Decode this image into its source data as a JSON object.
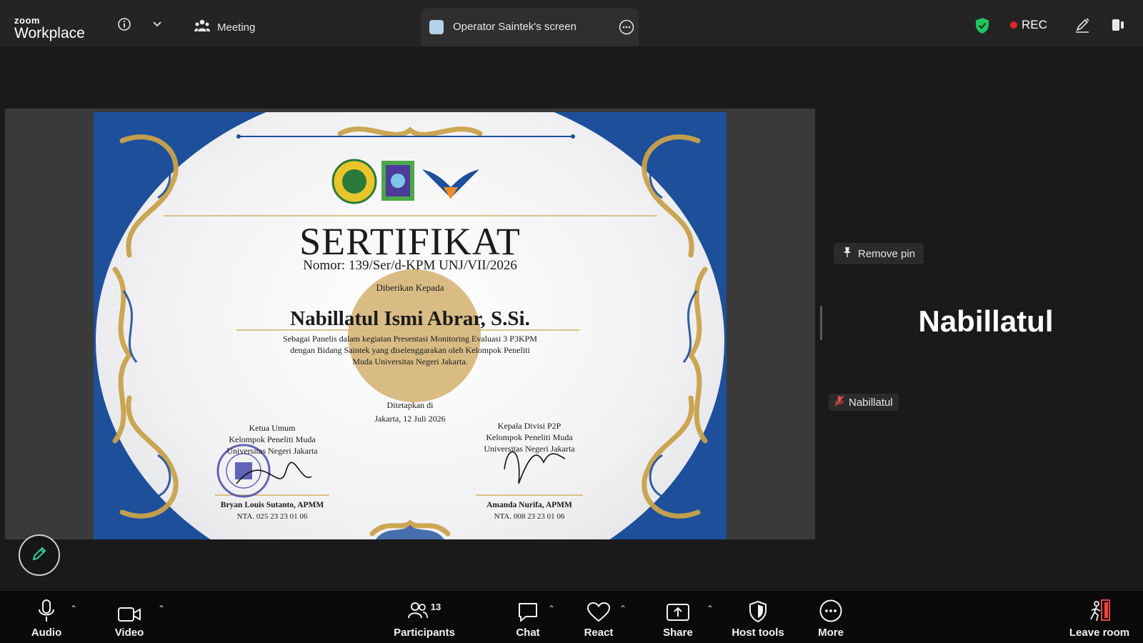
{
  "app": {
    "logo_top": "zoom",
    "logo_bottom": "Workplace"
  },
  "topbar": {
    "meeting_label": "Meeting",
    "share_tab_label": "Operator Saintek's screen",
    "rec_label": "REC",
    "colors": {
      "bar": "#242424",
      "shield": "#22c55e",
      "rec_dot": "#e02828"
    }
  },
  "certificate": {
    "title": "SERTIFIKAT",
    "number": "Nomor: 139/Ser/d-KPM UNJ/VII/2026",
    "given_to": "Diberikan Kepada",
    "recipient": "Nabillatul Ismi Abrar, S.Si.",
    "description": [
      "Sebagai Panelis dalam kegiatan Presentasi Monitoring Evaluasi 3 P3KPM",
      "dengan Bidang Saintek yang diselenggarakan oleh Kelompok Peneliti",
      "Muda Universitas Negeri Jakarta."
    ],
    "set_at_line1": "Ditetapkan di",
    "set_at_line2": "Jakarta, 12 Juli 2026",
    "signer_left": {
      "role": [
        "Ketua Umum",
        "Kelompok Peneliti Muda",
        "Universitas Negeri Jakarta"
      ],
      "name": "Bryan Louis Sutanto, APMM",
      "nta": "NTA. 025 23 23 01 06"
    },
    "signer_right": {
      "role": [
        "Kepala Divisi P2P",
        "Kelompok Peneliti Muda",
        "Universitas Negeri Jakarta"
      ],
      "name": "Amanda Nurifa, APMM",
      "nta": "NTA. 008 23 23 01 06"
    },
    "colors": {
      "border_blue": "#1d4f9b",
      "ornament_gold": "#c9a24a",
      "seal_gold": "#d6b679"
    }
  },
  "side_panel": {
    "remove_pin_label": "Remove pin",
    "participant_big_name": "Nabillatul",
    "participant_tag": "Nabillatul"
  },
  "toolbar": {
    "audio": "Audio",
    "video": "Video",
    "participants": "Participants",
    "participants_count": "13",
    "chat": "Chat",
    "react": "React",
    "share": "Share",
    "host_tools": "Host tools",
    "more": "More",
    "leave": "Leave room"
  }
}
